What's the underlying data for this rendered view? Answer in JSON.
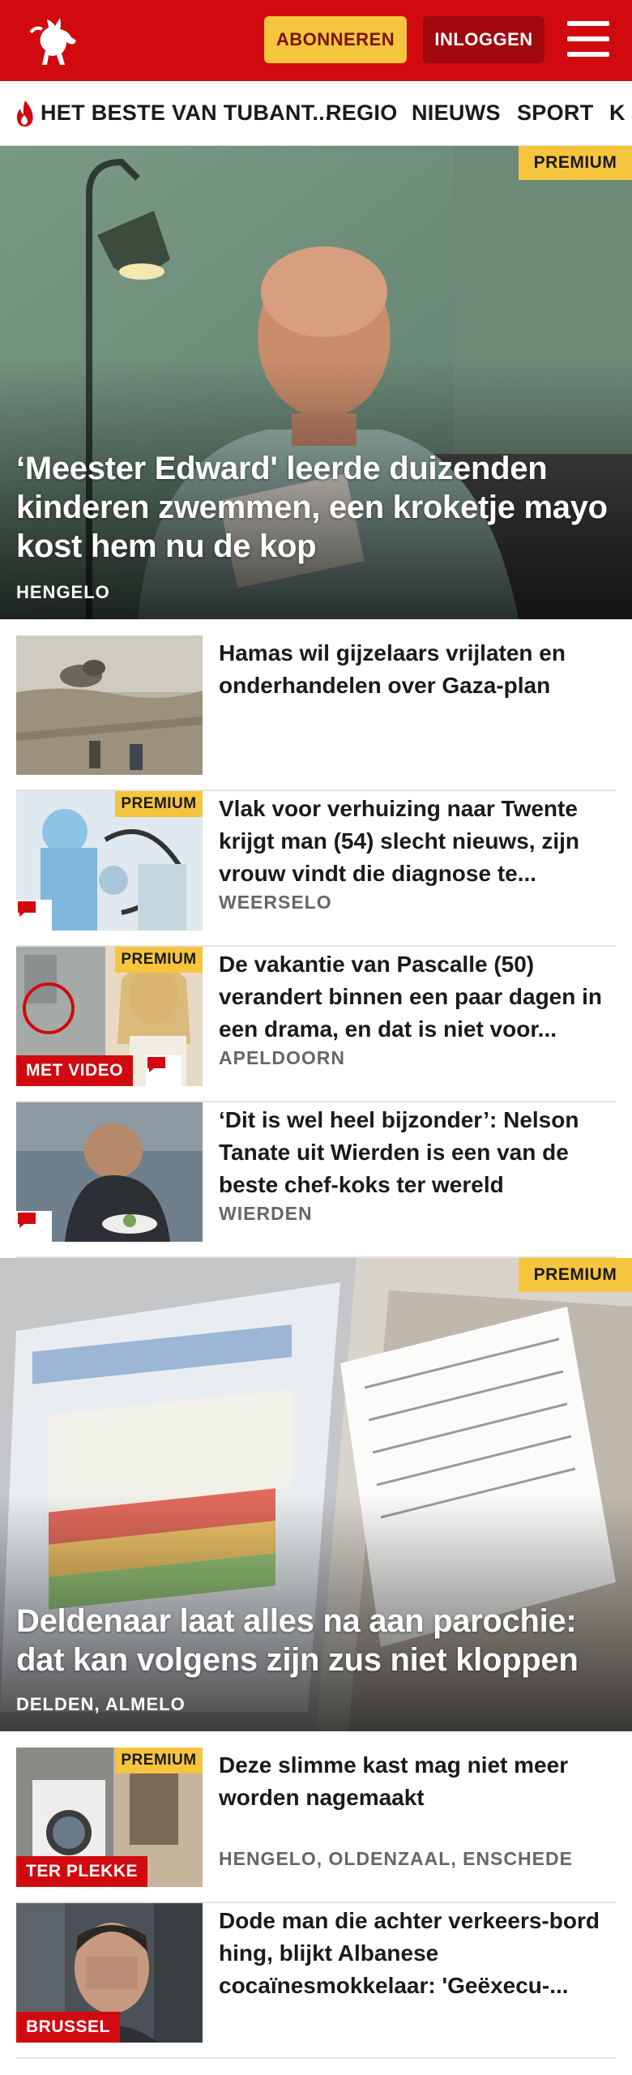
{
  "header": {
    "subscribe_label": "ABONNEREN",
    "login_label": "INLOGGEN"
  },
  "nav": {
    "items": [
      "HET BESTE VAN TUBANT...",
      "REGIO",
      "NIEUWS",
      "SPORT",
      "K"
    ]
  },
  "hero1": {
    "badge": "PREMIUM",
    "title": "‘Meester Edward' leerde duizenden kinderen zwemmen, een kroketje mayo kost hem nu de kop",
    "location": "HENGELO"
  },
  "articles": [
    {
      "title": "Hamas wil gijzelaars vrijlaten en onderhandelen over Gaza-plan",
      "location": ""
    },
    {
      "badge": "PREMIUM",
      "title": "Vlak voor verhuizing naar Twente krijgt man (54) slecht nieuws, zijn vrouw vindt die diagnose te...",
      "location": "WEERSELO"
    },
    {
      "badge": "PREMIUM",
      "tag": "MET VIDEO",
      "title": "De vakantie van Pascalle (50) verandert binnen een paar dagen in een drama, en dat is niet voor...",
      "location": "APELDOORN"
    },
    {
      "title": "‘Dit is wel heel bijzonder’: Nelson Tanate uit Wierden is een van de beste chef-koks ter wereld",
      "location": "WIERDEN"
    }
  ],
  "hero2": {
    "badge": "PREMIUM",
    "title": "Deldenaar laat alles na aan parochie: dat kan volgens zijn zus niet kloppen",
    "location": "DELDEN, ALMELO"
  },
  "articles2": [
    {
      "badge": "PREMIUM",
      "tag": "TER PLEKKE",
      "title": "Deze slimme kast mag niet meer worden nagemaakt",
      "location": "HENGELO, OLDENZAAL, ENSCHEDE"
    },
    {
      "tag": "BRUSSEL",
      "title": "Dode man die achter verkeers-bord hing, blijkt Albanese cocaïnesmokkelaar: 'Geëxecu-...",
      "location": ""
    }
  ],
  "colors": {
    "brand_red": "#d10a10",
    "premium_yellow": "#f6c53e",
    "login_dark_red": "#a1070d"
  },
  "icons": [
    "horse-logo-icon",
    "menu-icon",
    "flame-icon",
    "comment-icon"
  ]
}
